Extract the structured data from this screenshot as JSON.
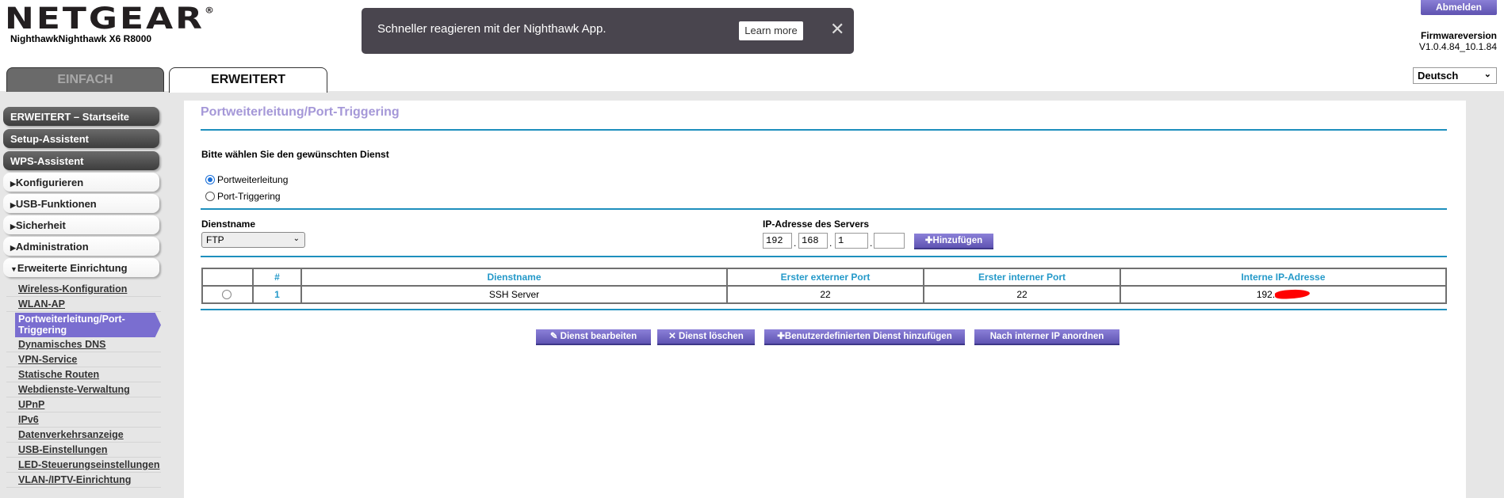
{
  "header": {
    "logo": "NETGEAR",
    "model": "NighthawkNighthawk X6 R8000",
    "logout": "Abmelden",
    "firmware_label": "Firmwareversion",
    "firmware_version": "V1.0.4.84_10.1.84",
    "language": "Deutsch"
  },
  "toast": {
    "message": "Schneller reagieren mit der Nighthawk App.",
    "learn_more": "Learn more",
    "close": "✕"
  },
  "tabs": [
    {
      "label": "EINFACH"
    },
    {
      "label": "ERWEITERT"
    }
  ],
  "sidebar": {
    "dark": [
      "ERWEITERT – Startseite",
      "Setup-Assistent",
      "WPS-Assistent"
    ],
    "sections": [
      "Konfigurieren",
      "USB-Funktionen",
      "Sicherheit",
      "Administration",
      "Erweiterte Einrichtung"
    ],
    "links": [
      "Wireless-Konfiguration",
      "WLAN-AP",
      "Portweiterleitung/Port-Triggering",
      "Dynamisches DNS",
      "VPN-Service",
      "Statische Routen",
      "Webdienste-Verwaltung",
      "UPnP",
      "IPv6",
      "Datenverkehrsanzeige",
      "USB-Einstellungen",
      "LED-Steuerungseinstellungen",
      "VLAN-/IPTV-Einrichtung"
    ]
  },
  "main": {
    "title": "Portweiterleitung/Port-Triggering",
    "prompt": "Bitte wählen Sie den gewünschten Dienst",
    "radio_forwarding": "Portweiterleitung",
    "radio_triggering": "Port-Triggering",
    "service_label": "Dienstname",
    "service_value": "FTP",
    "ip_label": "IP-Adresse des Servers",
    "ip": [
      "192",
      "168",
      "1",
      ""
    ],
    "add": "Hinzufügen",
    "table": {
      "headers": [
        "#",
        "Dienstname",
        "Erster externer Port",
        "Erster interner Port",
        "Interne IP-Adresse"
      ],
      "rows": [
        {
          "num": "1",
          "name": "SSH Server",
          "ext": "22",
          "int": "22",
          "ip": "192."
        }
      ]
    },
    "buttons": [
      "Dienst bearbeiten",
      "Dienst löschen",
      "Benutzerdefinierten Dienst hinzufügen",
      "Nach interner IP anordnen"
    ]
  }
}
